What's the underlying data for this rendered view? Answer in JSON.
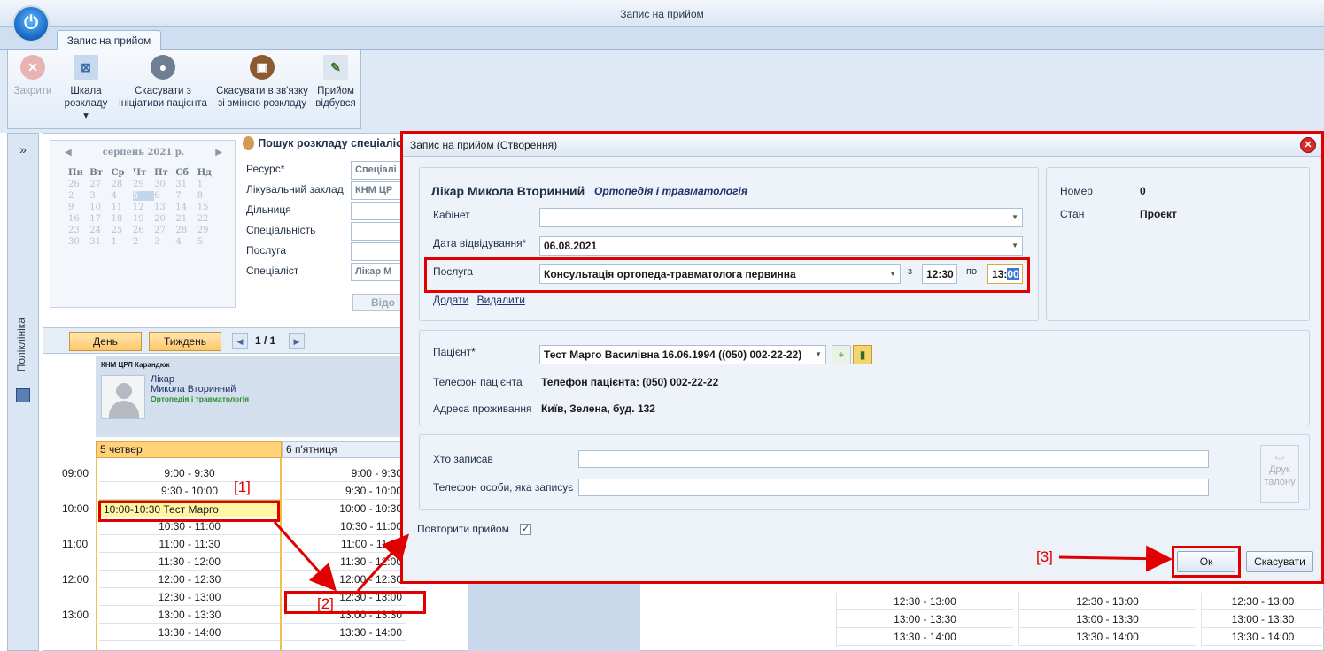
{
  "window": {
    "title": "Запис на прийом"
  },
  "ribbon": {
    "tab_label": "Запис на прийом",
    "buttons": [
      {
        "line1": "Закрити",
        "line2": ""
      },
      {
        "line1": "Шкала",
        "line2": "розкладу ▾"
      },
      {
        "line1": "Скасувати з",
        "line2": "ініціативи пацієнта"
      },
      {
        "line1": "Скасувати в зв'язку",
        "line2": "зі зміною розкладу"
      },
      {
        "line1": "Прийом",
        "line2": "відбувся"
      }
    ]
  },
  "sidebar": {
    "collapse_glyph": "»",
    "section_label": "Поліклініка"
  },
  "calendar": {
    "month": "серпень 2021 р.",
    "weekdays": [
      "Пн",
      "Вт",
      "Ср",
      "Чт",
      "Пт",
      "Сб",
      "Нд"
    ],
    "weeks": [
      [
        "26",
        "27",
        "28",
        "29",
        "30",
        "31",
        "1"
      ],
      [
        "2",
        "3",
        "4",
        "5",
        "6",
        "7",
        "8"
      ],
      [
        "9",
        "10",
        "11",
        "12",
        "13",
        "14",
        "15"
      ],
      [
        "16",
        "17",
        "18",
        "19",
        "20",
        "21",
        "22"
      ],
      [
        "23",
        "24",
        "25",
        "26",
        "27",
        "28",
        "29"
      ],
      [
        "30",
        "31",
        "1",
        "2",
        "3",
        "4",
        "5"
      ]
    ]
  },
  "search": {
    "title": "Пошук розкладу спеціаліс",
    "fields": [
      {
        "label": "Ресурс*",
        "value": "Спеціалі"
      },
      {
        "label": "Лікувальний заклад",
        "value": "КНМ ЦР"
      },
      {
        "label": "Дільниця",
        "value": ""
      },
      {
        "label": "Спеціальність",
        "value": ""
      },
      {
        "label": "Послуга",
        "value": ""
      },
      {
        "label": "Спеціаліст",
        "value": "Лікар М"
      }
    ],
    "find_button": "Відо"
  },
  "schedule": {
    "day_button": "День",
    "week_button": "Тиждень",
    "page_indicator": "1 / 1",
    "clinic": "КНМ ЦРЛ Карандюк",
    "doctor_role": "Лікар",
    "doctor_name": "Микола Вторинний",
    "doctor_spec": "Ортопедія і травматологія",
    "day1": "5 четвер",
    "day2": "6 п'ятниця",
    "hours": [
      "09:00",
      "10:00",
      "11:00",
      "12:00",
      "13:00"
    ],
    "col1_slots": [
      "9:00 - 9:30",
      "9:30 - 10:00",
      "10:00-10:30 Тест Марго",
      "10:30 - 11:00",
      "11:00 - 11:30",
      "11:30 - 12:00",
      "12:00 - 12:30",
      "12:30 - 13:00",
      "13:00 - 13:30",
      "13:30 - 14:00"
    ],
    "col2_slots": [
      "9:00 - 9:30",
      "9:30 - 10:00",
      "10:00 - 10:30",
      "10:30 - 11:00",
      "11:00 - 11:30",
      "11:30 - 12:00",
      "12:00 - 12:30",
      "12:30 - 13:00",
      "13:00 - 13:30",
      "13:30 - 14:00"
    ],
    "right_slots": [
      "12:30 - 13:00",
      "13:00 - 13:30",
      "13:30 - 14:00"
    ]
  },
  "markers": {
    "m1": "[1]",
    "m2": "[2]",
    "m3": "[3]"
  },
  "dialog": {
    "title": "Запис на прийом (Створення)",
    "doctor": "Лікар Микола Вторинний",
    "specialty": "Ортопедія і травматологія",
    "cabinet_label": "Кабінет",
    "cabinet_value": "",
    "date_label": "Дата відвідування*",
    "date_value": "06.08.2021",
    "service_label": "Послуга",
    "service_value": "Консультація ортопеда-травматолога первинна",
    "from_label": "з",
    "from_value": "12:30",
    "to_label": "по",
    "to_value_a": "13:",
    "to_value_b": "00",
    "add_link": "Додати",
    "remove_link": "Видалити",
    "number_label": "Номер",
    "number_value": "0",
    "state_label": "Стан",
    "state_value": "Проект",
    "patient_label": "Пацієнт*",
    "patient_value": "Тест Марго Василівна 16.06.1994 ((050) 002-22-22)",
    "phone_label": "Телефон пацієнта",
    "phone_value": "Телефон пацієнта: (050) 002-22-22",
    "address_label": "Адреса проживання",
    "address_value": "Київ, Зелена, буд. 132",
    "who_label": "Хто записав",
    "who_phone_label": "Телефон особи, яка записує",
    "print_line1": "Друк",
    "print_line2": "талону",
    "repeat_label": "Повторити прийом",
    "ok_button": "Ок",
    "cancel_button": "Скасувати"
  },
  "colors": {
    "accent": "#e00000",
    "ribbon": "#dfe9f5",
    "today": "#ffd27a"
  }
}
